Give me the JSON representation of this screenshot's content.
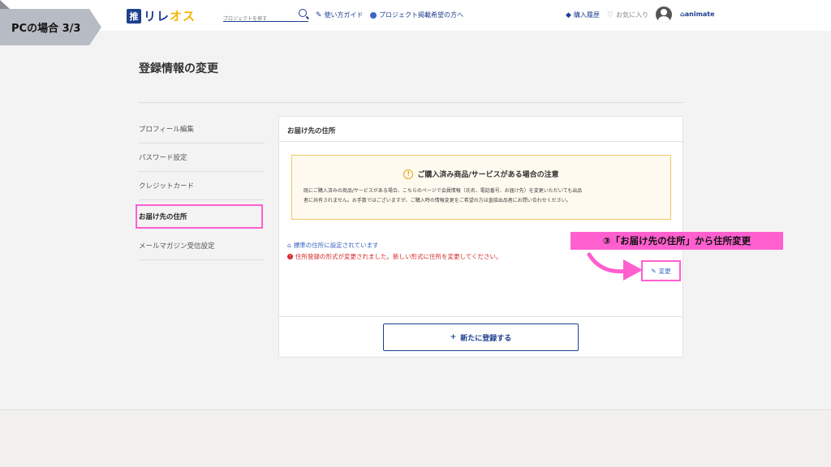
{
  "badge": {
    "label": "PCの場合 3/3"
  },
  "header": {
    "logo_mark": "推",
    "logo_text_a": "リレ",
    "logo_text_b": "オス",
    "search_placeholder": "プロジェクトを探す",
    "guide_label": "使い方ガイド",
    "project_label": "プロジェクト掲載希望の方へ",
    "purchase_label": "購入履歴",
    "favorite_label": "お気に入り",
    "animate_label": "animate"
  },
  "page": {
    "title": "登録情報の変更"
  },
  "sidebar": {
    "items": [
      {
        "label": "プロフィール編集"
      },
      {
        "label": "パスワード設定"
      },
      {
        "label": "クレジットカード"
      },
      {
        "label": "お届け先の住所"
      },
      {
        "label": "メールマガジン受信設定"
      }
    ]
  },
  "card": {
    "title": "お届け先の住所",
    "notice_title": "ご購入済み商品/サービスがある場合の注意",
    "notice_line1": "既にご購入済みの商品/サービスがある場合、こちらのページで会員情報（氏名、電話番号、お届け先）を変更いただいても出品",
    "notice_line2": "者に共有されません。お手数ではございますが、ご購入時の情報変更をご希望の方は直接出品者にお問い合わせください。",
    "default_address": "標準の住所に設定されています",
    "format_error": "住所登録の形式が変更されました。新しい形式に住所を変更してください。",
    "edit_label": "変更",
    "register_label": "新たに登録する"
  },
  "annotation": {
    "text": "③「お届け先の住所」から住所変更"
  }
}
